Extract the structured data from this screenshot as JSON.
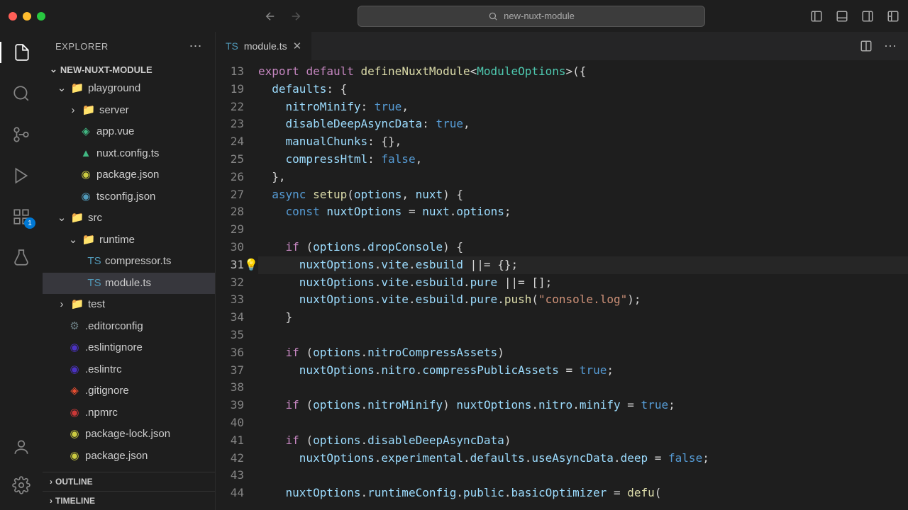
{
  "titlebar": {
    "search_text": "new-nuxt-module"
  },
  "activity": {
    "ext_badge": "1"
  },
  "sidebar": {
    "title": "EXPLORER",
    "project": "NEW-NUXT-MODULE",
    "tree": {
      "playground": "playground",
      "server": "server",
      "app_vue": "app.vue",
      "nuxt_config": "nuxt.config.ts",
      "package_json_1": "package.json",
      "tsconfig": "tsconfig.json",
      "src": "src",
      "runtime": "runtime",
      "compressor": "compressor.ts",
      "module": "module.ts",
      "test": "test",
      "editorconfig": ".editorconfig",
      "eslintignore": ".eslintignore",
      "eslintrc": ".eslintrc",
      "gitignore": ".gitignore",
      "npmrc": ".npmrc",
      "pkg_lock": "package-lock.json",
      "package_json_2": "package.json"
    },
    "outline": "OUTLINE",
    "timeline": "TIMELINE"
  },
  "tab": {
    "name": "module.ts"
  },
  "gutter": [
    "13",
    "19",
    "22",
    "23",
    "24",
    "25",
    "26",
    "27",
    "28",
    "29",
    "30",
    "31",
    "32",
    "33",
    "34",
    "35",
    "36",
    "37",
    "38",
    "39",
    "40",
    "41",
    "42",
    "43",
    "44"
  ],
  "code": {
    "l13": {
      "export": "export",
      "default": "default",
      "fn": "defineNuxtModule",
      "ty": "ModuleOptions"
    },
    "l19": {
      "prop": "defaults",
      "brace": ": {"
    },
    "l22": {
      "prop": "nitroMinify",
      "val": "true"
    },
    "l23": {
      "prop": "disableDeepAsyncData",
      "val": "true"
    },
    "l24": {
      "prop": "manualChunks",
      "val": "{}"
    },
    "l25": {
      "prop": "compressHtml",
      "val": "false"
    },
    "l27": {
      "async": "async",
      "fn": "setup",
      "p1": "options",
      "p2": "nuxt"
    },
    "l28": {
      "const": "const",
      "name": "nuxtOptions",
      "nuxt": "nuxt",
      "opts": "options"
    },
    "l30": {
      "if": "if",
      "opts": "options",
      "prop": "dropConsole"
    },
    "l31": {
      "a": "nuxtOptions",
      "b": "vite",
      "c": "esbuild",
      "val": "{}"
    },
    "l32": {
      "a": "nuxtOptions",
      "b": "vite",
      "c": "esbuild",
      "d": "pure",
      "val": "[]"
    },
    "l33": {
      "a": "nuxtOptions",
      "b": "vite",
      "c": "esbuild",
      "d": "pure",
      "fn": "push",
      "str": "\"console.log\""
    },
    "l36": {
      "if": "if",
      "opts": "options",
      "prop": "nitroCompressAssets"
    },
    "l37": {
      "a": "nuxtOptions",
      "b": "nitro",
      "c": "compressPublicAssets",
      "val": "true"
    },
    "l39": {
      "if": "if",
      "opts": "options",
      "prop": "nitroMinify",
      "a": "nuxtOptions",
      "b": "nitro",
      "c": "minify",
      "val": "true"
    },
    "l41": {
      "if": "if",
      "opts": "options",
      "prop": "disableDeepAsyncData"
    },
    "l42": {
      "a": "nuxtOptions",
      "b": "experimental",
      "c": "defaults",
      "d": "useAsyncData",
      "e": "deep",
      "val": "false"
    },
    "l44": {
      "a": "nuxtOptions",
      "b": "runtimeConfig",
      "c": "public",
      "d": "basicOptimizer",
      "fn": "defu"
    }
  }
}
